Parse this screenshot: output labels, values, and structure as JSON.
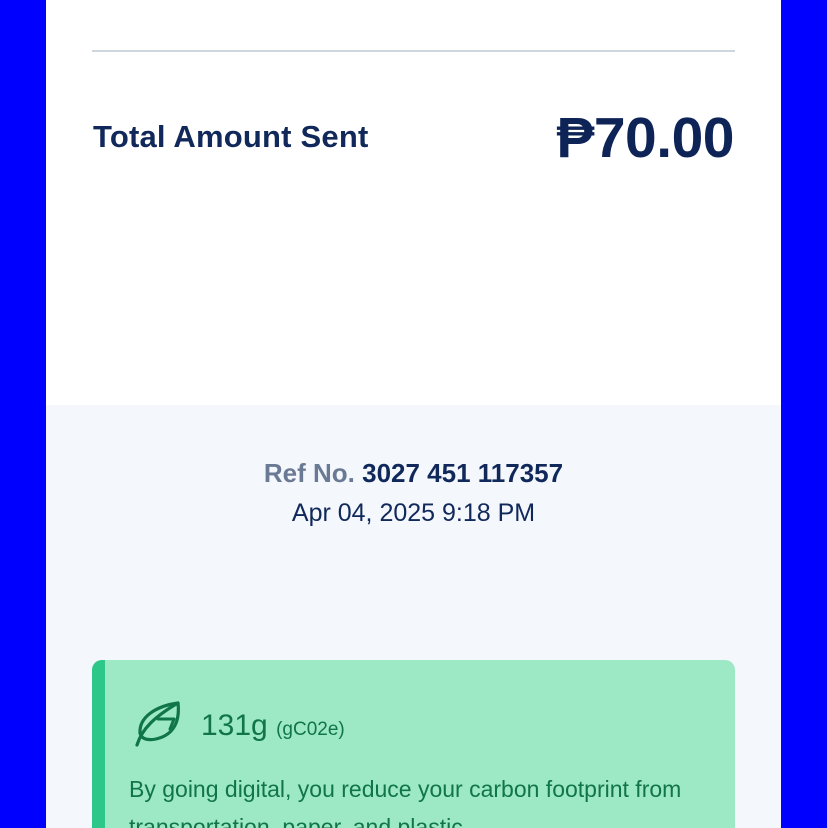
{
  "receipt": {
    "total_label": "Total Amount Sent",
    "total_amount": "₱70.00",
    "ref_label": "Ref No.",
    "ref_number": "3027 451 117357",
    "datetime": "Apr 04, 2025 9:18 PM"
  },
  "eco": {
    "icon": "leaf-icon",
    "amount": "131g",
    "unit": "(gC02e)",
    "message": "By going digital, you reduce your carbon footprint from transportation, paper, and plastic"
  },
  "colors": {
    "background": "#0000ff",
    "primary_text": "#10285a",
    "eco_card": "#9de8c5",
    "eco_accent": "#2ec78a",
    "eco_text": "#107549"
  }
}
